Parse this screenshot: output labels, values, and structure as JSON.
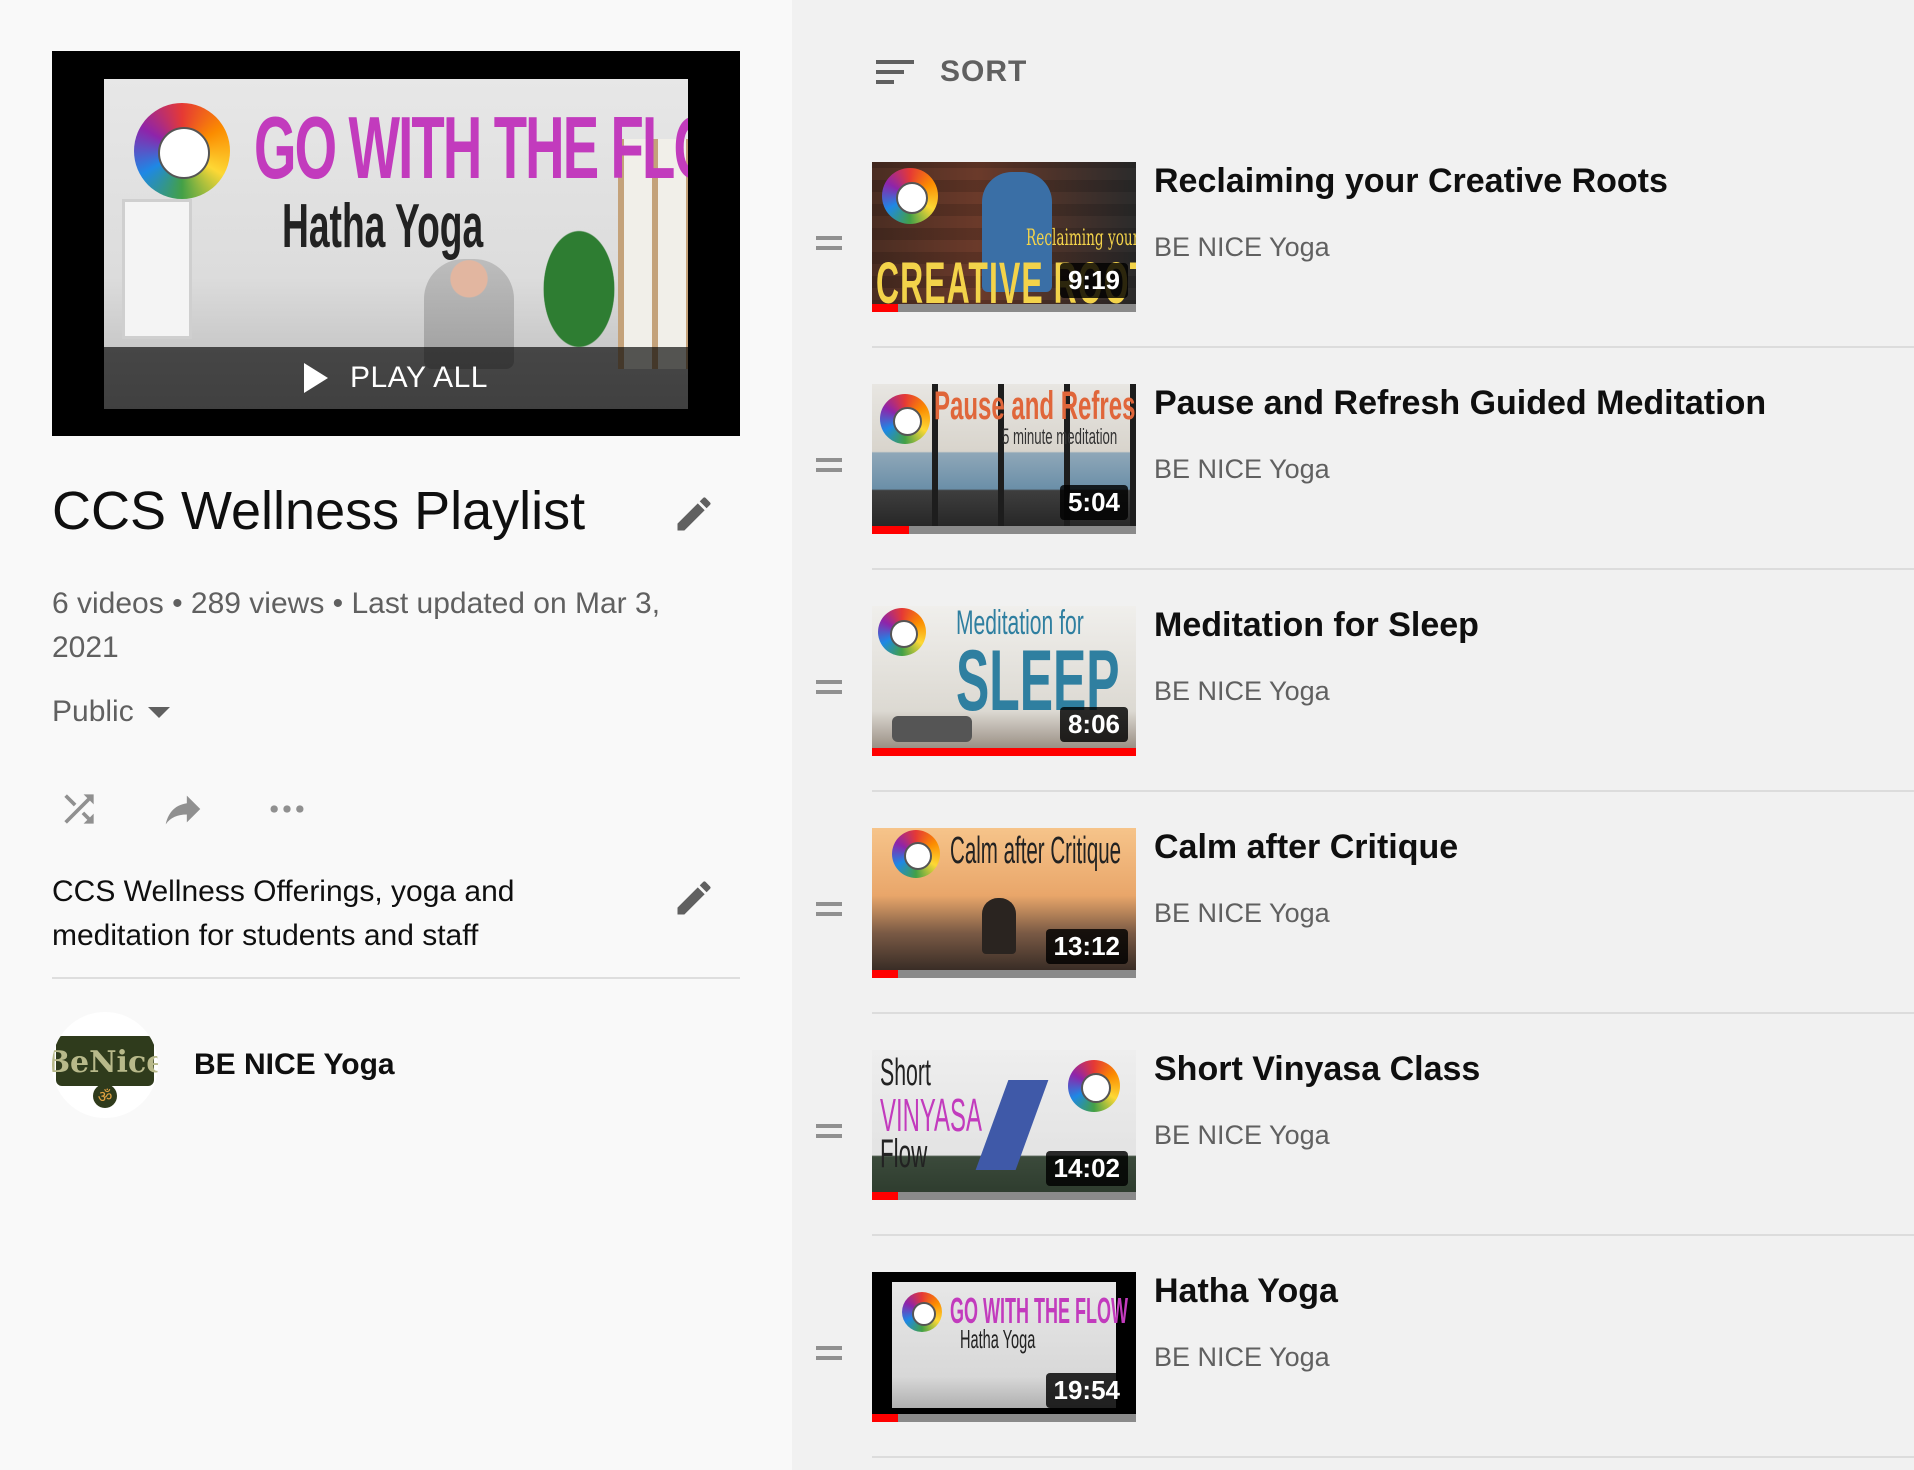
{
  "hero": {
    "thumb_title_line1": "GO WITH THE FLOW",
    "thumb_title_line2": "Hatha Yoga",
    "play_all_label": "PLAY ALL"
  },
  "playlist": {
    "title": "CCS Wellness Playlist",
    "meta": "6 videos • 289 views • Last updated on Mar 3, 2021",
    "privacy": "Public",
    "description": "CCS Wellness Offerings, yoga and meditation for students and staff"
  },
  "owner": {
    "name": "BE NICE Yoga",
    "avatar_text": "BeNice"
  },
  "sort": {
    "label": "SORT"
  },
  "videos": [
    {
      "title": "Reclaiming your Creative Roots",
      "channel": "BE NICE Yoga",
      "duration": "9:19",
      "progress": 0.1,
      "thumb_text": "CREATIVE ROOTS",
      "thumb_sub": "Reclaiming your"
    },
    {
      "title": "Pause and Refresh Guided Meditation",
      "channel": "BE NICE Yoga",
      "duration": "5:04",
      "progress": 0.14,
      "thumb_text": "Pause and Refresh",
      "thumb_sub": "5 minute meditation"
    },
    {
      "title": "Meditation for Sleep",
      "channel": "BE NICE Yoga",
      "duration": "8:06",
      "progress": 1.0,
      "thumb_text": "SLEEP",
      "thumb_sub": "Meditation for"
    },
    {
      "title": "Calm after Critique",
      "channel": "BE NICE Yoga",
      "duration": "13:12",
      "progress": 0.1,
      "thumb_text": "Calm after Critique",
      "thumb_sub": ""
    },
    {
      "title": "Short Vinyasa Class",
      "channel": "BE NICE Yoga",
      "duration": "14:02",
      "progress": 0.1,
      "thumb_text": "VINYASA",
      "thumb_sub": "Short",
      "thumb_sub2": "Flow"
    },
    {
      "title": "Hatha Yoga",
      "channel": "BE NICE Yoga",
      "duration": "19:54",
      "progress": 0.1,
      "thumb_text": "GO WITH THE FLOW",
      "thumb_sub": "Hatha Yoga"
    }
  ],
  "colors": {
    "progress_red": "#ff0000",
    "text_primary": "#0f0f0f",
    "text_secondary": "#606060",
    "left_bg": "#f9f9f9",
    "right_bg": "#f1f1f1"
  }
}
